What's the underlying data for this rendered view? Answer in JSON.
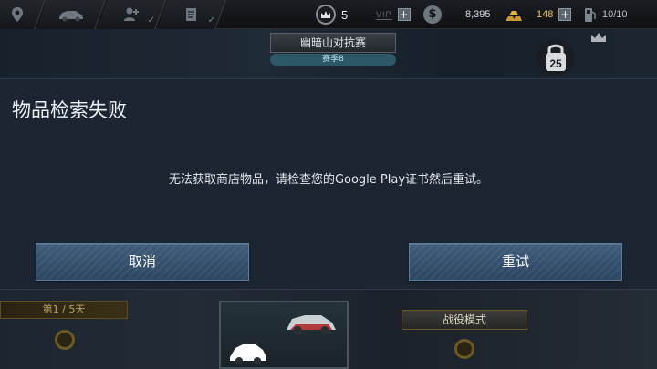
{
  "hud": {
    "crowns": "5",
    "vip_label": "VIP",
    "plus": "+",
    "money": "8,395",
    "gold": "148",
    "fuel": "10/10",
    "coin_symbol": "$"
  },
  "background": {
    "event_title": "幽暗山对抗赛",
    "season_label": "赛季8",
    "badge_number": "25",
    "day_label": "第1 / 5天",
    "mode_label": "战役模式"
  },
  "dialog": {
    "title": "物品检索失败",
    "message": "无法获取商店物品，请检查您的Google Play证书然后重试。",
    "cancel_label": "取消",
    "retry_label": "重试"
  },
  "colors": {
    "dialog_bg": "#1c2633",
    "button_bg": "#3f5d7b",
    "gold": "#e9c35a"
  },
  "icons": [
    "map-pin-icon",
    "car-icon",
    "user-add-icon",
    "document-icon",
    "crown-icon",
    "coin-icon",
    "gold-bars-icon",
    "fuel-pump-icon"
  ]
}
